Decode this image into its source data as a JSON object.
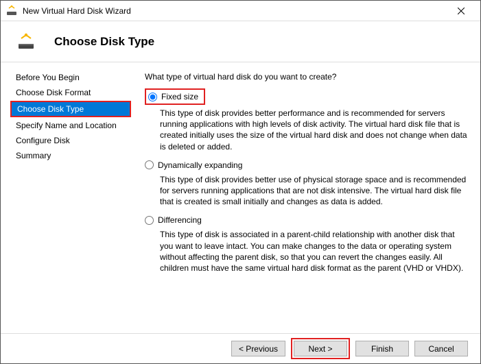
{
  "window": {
    "title": "New Virtual Hard Disk Wizard"
  },
  "header": {
    "page_title": "Choose Disk Type"
  },
  "sidebar": {
    "steps": [
      {
        "label": "Before You Begin"
      },
      {
        "label": "Choose Disk Format"
      },
      {
        "label": "Choose Disk Type"
      },
      {
        "label": "Specify Name and Location"
      },
      {
        "label": "Configure Disk"
      },
      {
        "label": "Summary"
      }
    ],
    "active_index": 2
  },
  "main": {
    "question": "What type of virtual hard disk do you want to create?",
    "options": [
      {
        "label": "Fixed size",
        "selected": true,
        "highlighted": true,
        "description": "This type of disk provides better performance and is recommended for servers running applications with high levels of disk activity. The virtual hard disk file that is created initially uses the size of the virtual hard disk and does not change when data is deleted or added."
      },
      {
        "label": "Dynamically expanding",
        "selected": false,
        "highlighted": false,
        "description": "This type of disk provides better use of physical storage space and is recommended for servers running applications that are not disk intensive. The virtual hard disk file that is created is small initially and changes as data is added."
      },
      {
        "label": "Differencing",
        "selected": false,
        "highlighted": false,
        "description": "This type of disk is associated in a parent-child relationship with another disk that you want to leave intact. You can make changes to the data or operating system without affecting the parent disk, so that you can revert the changes easily. All children must have the same virtual hard disk format as the parent (VHD or VHDX)."
      }
    ]
  },
  "footer": {
    "previous": "< Previous",
    "next": "Next >",
    "finish": "Finish",
    "cancel": "Cancel",
    "next_highlighted": true
  }
}
